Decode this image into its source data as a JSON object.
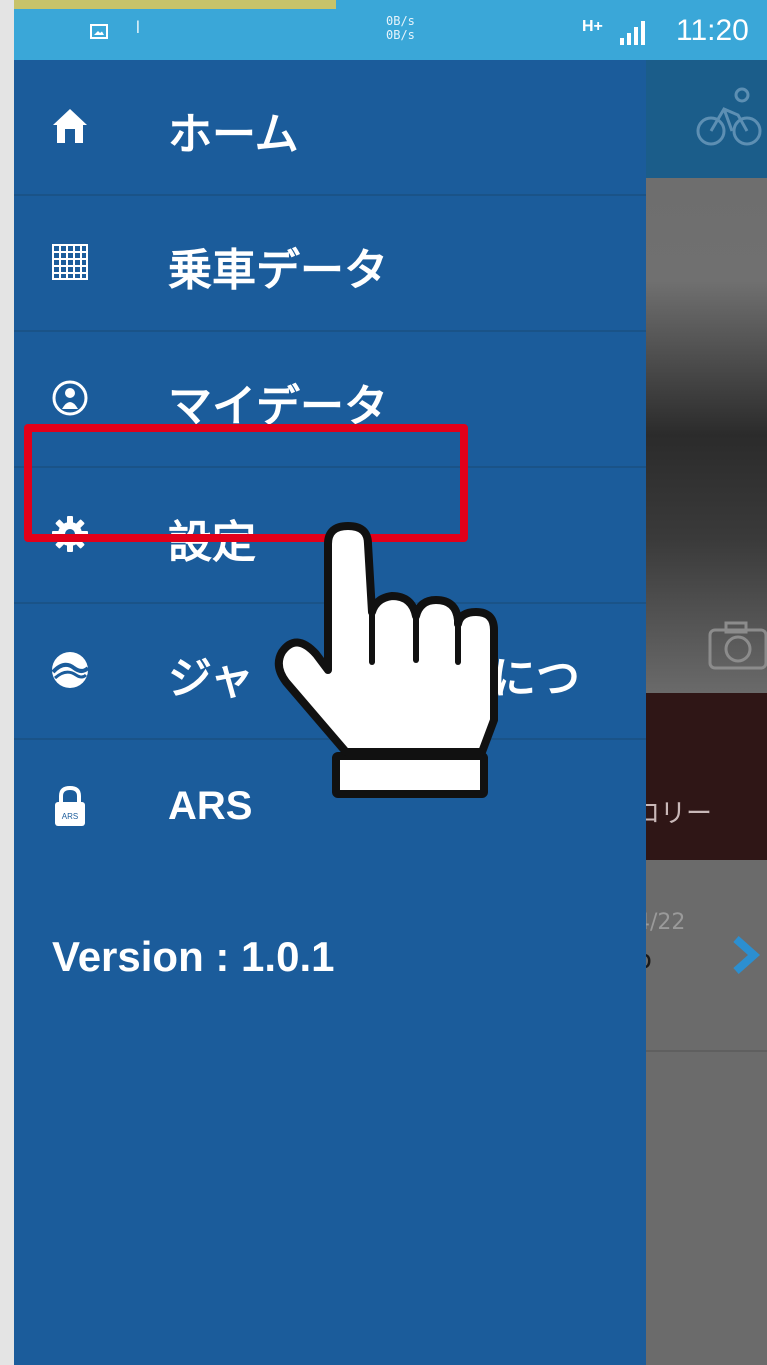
{
  "status_bar": {
    "net_speed_up": "0B/s",
    "net_speed_down": "0B/s",
    "network_type": "H+",
    "time": "11:20",
    "icons": [
      "image-notification-icon",
      "group-notification-icon",
      "signal-icon"
    ]
  },
  "drawer": {
    "items": [
      {
        "label": "ホーム",
        "icon": "home-icon"
      },
      {
        "label": "乗車データ",
        "icon": "grid-icon"
      },
      {
        "label": "マイデータ",
        "icon": "user-icon"
      },
      {
        "label": "設定",
        "icon": "gear-icon"
      },
      {
        "label": "ジャ",
        "label_end": "につ",
        "icon": "logo-icon"
      },
      {
        "label": "ARS",
        "icon": "lock-icon"
      }
    ],
    "version": "Version : 1.0.1"
  },
  "background_app": {
    "history_label": "ロリー",
    "list_date": "4/22",
    "list_fragment": "o",
    "icons": [
      "bike-icon",
      "camera-icon",
      "chevron-right-icon"
    ]
  },
  "overlay": {
    "highlight_color": "#e2001a",
    "pointer_icon": "hand-pointer-icon"
  },
  "colors": {
    "drawer_bg": "#1b5c9b",
    "status_bar": "#3aa7d8",
    "accent_chevron": "#2c8fd0"
  }
}
